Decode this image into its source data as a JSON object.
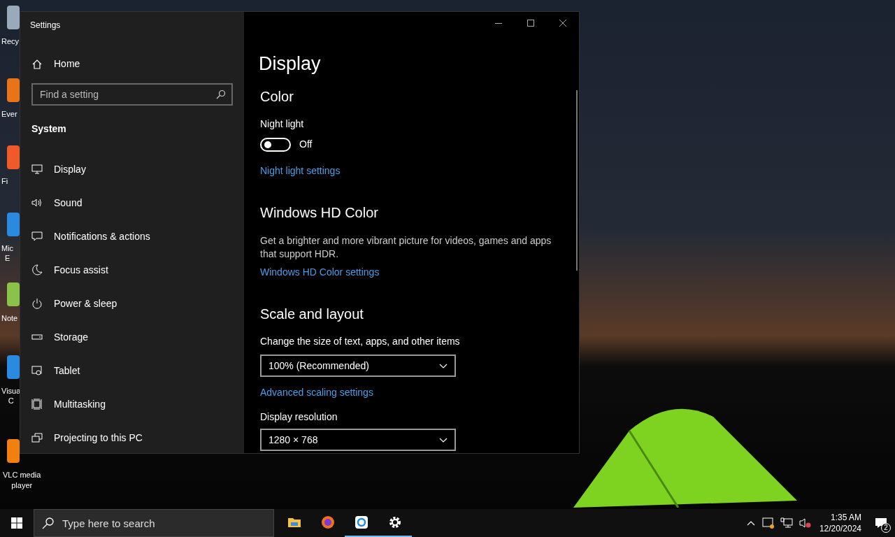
{
  "desktop_icons": [
    {
      "label": "Recy"
    },
    {
      "label": "Ever"
    },
    {
      "label": "Fi"
    },
    {
      "label": "Mic\nE"
    },
    {
      "label": "Note"
    },
    {
      "label": "Visua\nC"
    },
    {
      "label": "VLC media\nplayer"
    }
  ],
  "window": {
    "title": "Settings"
  },
  "sidebar": {
    "home": "Home",
    "search": {
      "placeholder": "Find a setting"
    },
    "section": "System",
    "items": [
      {
        "kind": "display",
        "label": "Display"
      },
      {
        "kind": "sound",
        "label": "Sound"
      },
      {
        "kind": "notifications",
        "label": "Notifications & actions"
      },
      {
        "kind": "focus",
        "label": "Focus assist"
      },
      {
        "kind": "power",
        "label": "Power & sleep"
      },
      {
        "kind": "storage",
        "label": "Storage"
      },
      {
        "kind": "tablet",
        "label": "Tablet"
      },
      {
        "kind": "multitasking",
        "label": "Multitasking"
      },
      {
        "kind": "projecting",
        "label": "Projecting to this PC"
      }
    ]
  },
  "content": {
    "title": "Display",
    "color": {
      "heading": "Color",
      "night_light_label": "Night light",
      "night_light": {
        "on": false,
        "state_text": "Off"
      },
      "link": "Night light settings"
    },
    "hd_color": {
      "heading": "Windows HD Color",
      "description": "Get a brighter and more vibrant picture for videos, games and apps that support HDR.",
      "link": "Windows HD Color settings"
    },
    "scale": {
      "heading": "Scale and layout",
      "size_label": "Change the size of text, apps, and other items",
      "size_value": "100% (Recommended)",
      "link": "Advanced scaling settings",
      "resolution_label": "Display resolution",
      "resolution_value": "1280 × 768"
    }
  },
  "taskbar": {
    "search": {
      "placeholder": "Type here to search"
    },
    "apps": [
      {
        "kind": "folder",
        "running": false
      },
      {
        "kind": "browser",
        "running": false
      },
      {
        "kind": "sync",
        "running": true
      },
      {
        "kind": "gear",
        "running": true
      }
    ],
    "time": "1:35 AM",
    "date": "12/20/2024",
    "notifications": "2"
  }
}
